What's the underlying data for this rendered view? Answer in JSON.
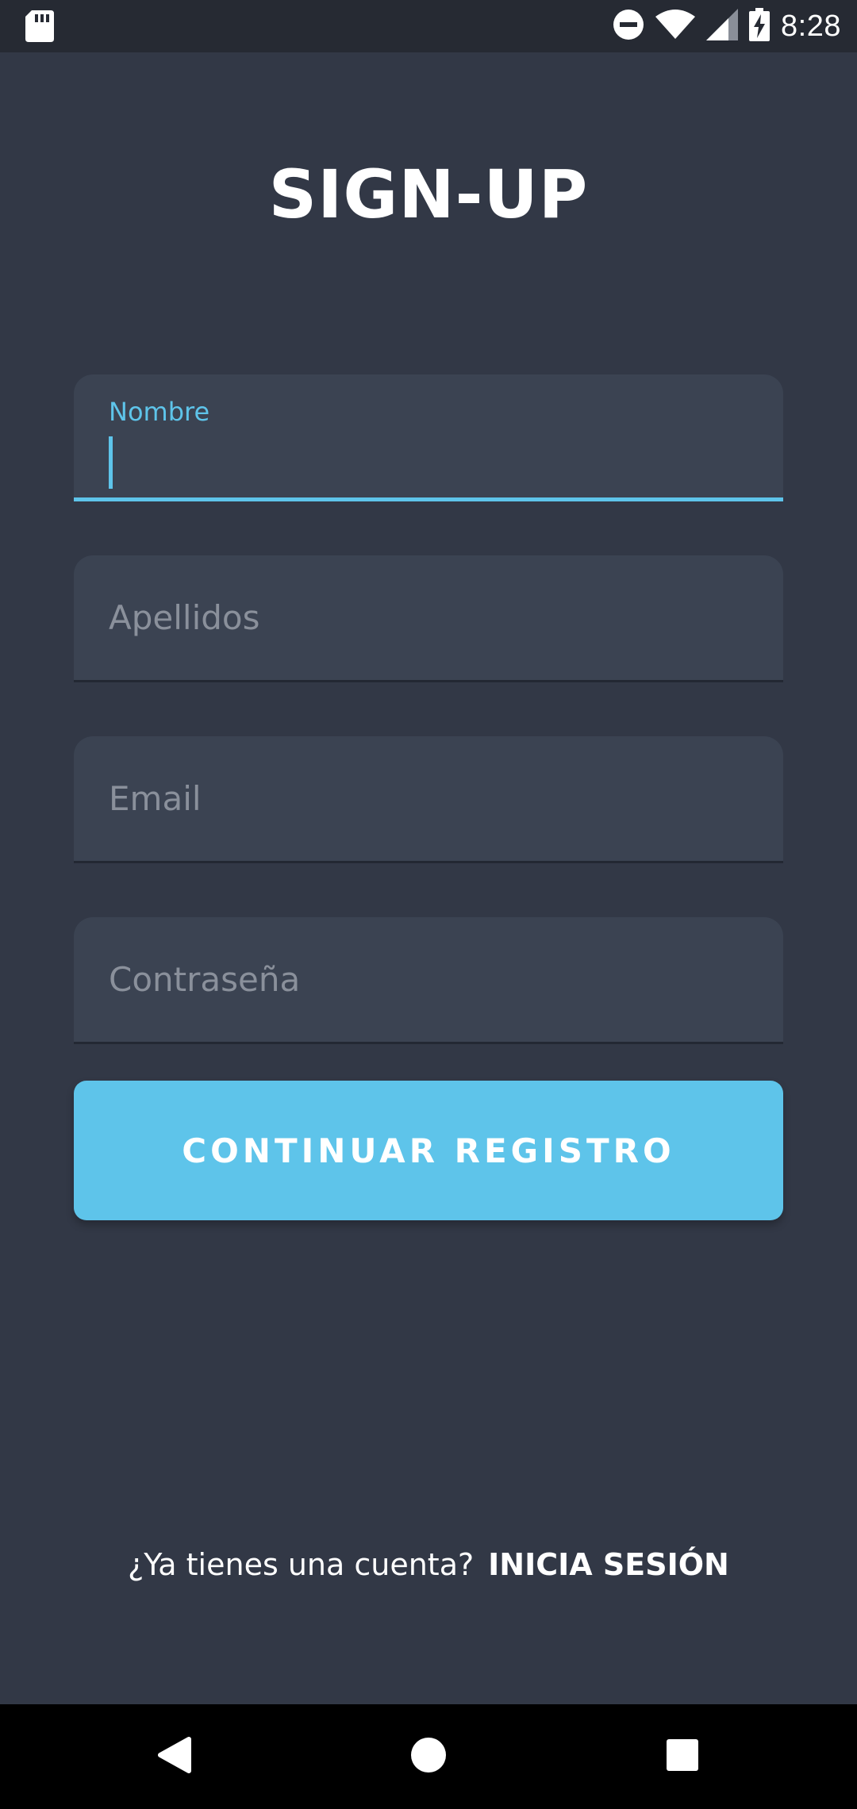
{
  "status_bar": {
    "time": "8:28",
    "icons": [
      "sd-card-icon",
      "do-not-disturb-icon",
      "wifi-icon",
      "signal-icon",
      "battery-charging-icon"
    ]
  },
  "page": {
    "title": "SIGN-UP"
  },
  "form": {
    "nombre": {
      "label": "Nombre",
      "value": ""
    },
    "apellidos": {
      "placeholder": "Apellidos",
      "value": ""
    },
    "email": {
      "placeholder": "Email",
      "value": ""
    },
    "password": {
      "placeholder": "Contraseña",
      "value": ""
    },
    "submit_label": "CONTINUAR REGISTRO"
  },
  "footer": {
    "question": "¿Ya tienes una cuenta?",
    "link": "INICIA SESIÓN"
  },
  "nav_bar": {
    "buttons": [
      "back-icon",
      "home-icon",
      "recents-icon"
    ]
  },
  "colors": {
    "background": "#323846",
    "field": "#3b4352",
    "accent": "#5ec4ea",
    "status_bar": "#262a33",
    "nav_bar": "#000000"
  }
}
